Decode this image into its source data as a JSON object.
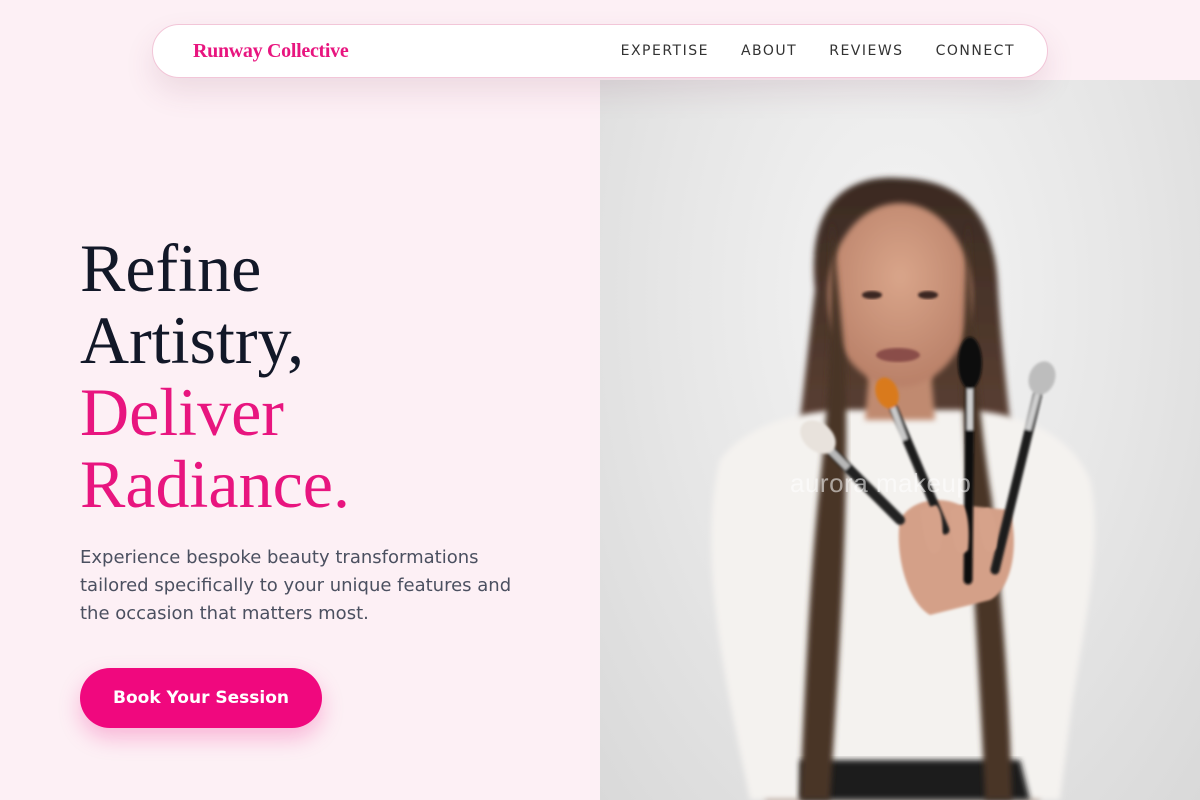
{
  "brand": {
    "name": "Runway Collective"
  },
  "nav": {
    "links": [
      "EXPERTISE",
      "ABOUT",
      "REVIEWS",
      "CONNECT"
    ]
  },
  "hero": {
    "line1": "Refine",
    "line2": "Artistry,",
    "line3": "Deliver",
    "line4": "Radiance.",
    "description": "Experience bespoke beauty transformations tailored specifically to your unique features and the occasion that matters most.",
    "cta_label": "Book Your Session"
  },
  "photo": {
    "watermark": "aurora makeup",
    "alt": "Makeup artist holding brushes"
  },
  "colors": {
    "accent": "#e8157f",
    "background": "#fdf0f5",
    "heading": "#121828",
    "body_text": "#4b5060"
  }
}
